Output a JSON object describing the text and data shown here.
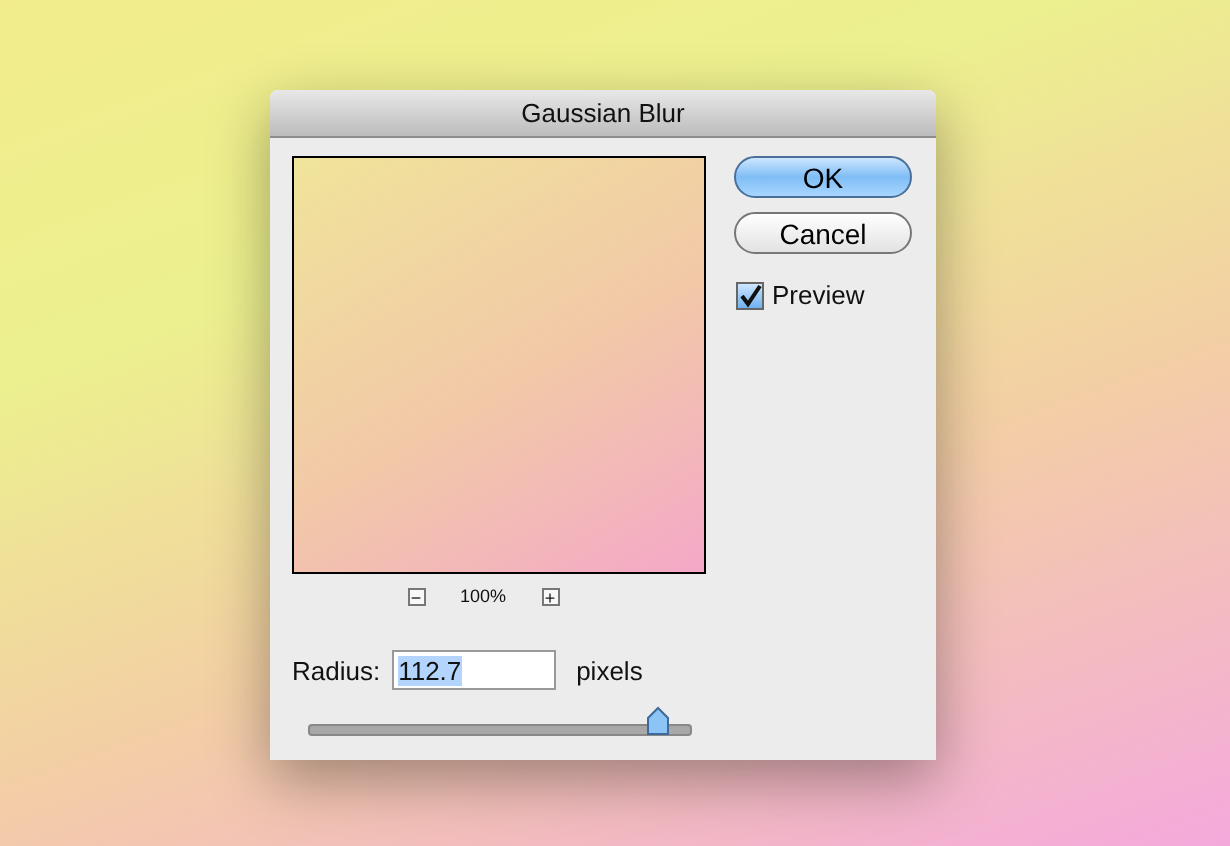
{
  "window": {
    "title": "Gaussian Blur"
  },
  "buttons": [
    {
      "label": "OK",
      "default": true
    },
    {
      "label": "Cancel",
      "default": false
    }
  ],
  "preview": {
    "label": "Preview",
    "checked": true
  },
  "zoom": {
    "minus": "−",
    "level": "100%",
    "plus": "+"
  },
  "radius": {
    "label": "Radius:",
    "value": "112.7",
    "value_selected": true,
    "unit": "pixels",
    "level": 0.91
  }
}
